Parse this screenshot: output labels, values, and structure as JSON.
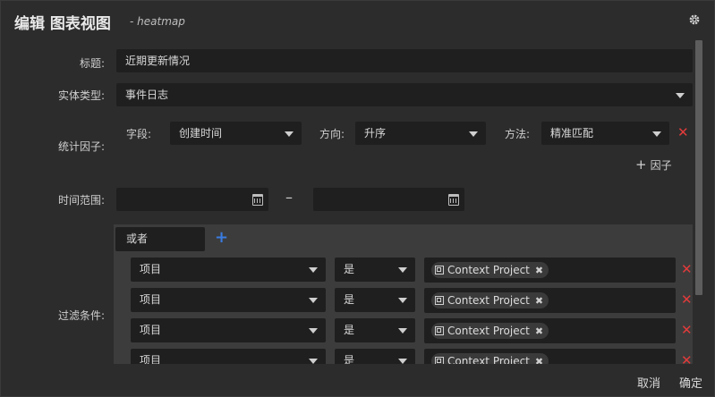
{
  "header": {
    "title": "编辑 图表视图",
    "subtitle": "- heatmap",
    "settings_icon": "gear-icon"
  },
  "form": {
    "title_label": "标题:",
    "title_value": "近期更新情况",
    "entity_label": "实体类型:",
    "entity_value": "事件日志",
    "factor_label": "统计因子:",
    "factor": {
      "field_label": "字段:",
      "field_value": "创建时间",
      "direction_label": "方向:",
      "direction_value": "升序",
      "method_label": "方法:",
      "method_value": "精准匹配",
      "remove_icon": "close-icon"
    },
    "add_factor_plus": "+",
    "add_factor_label": "因子",
    "time_label": "时间范围:",
    "time_start": "",
    "time_end": "",
    "time_dash": "–",
    "calendar_icon": "calendar-icon",
    "filter_label": "过滤条件:",
    "filter_logic": "或者",
    "filter_add_icon": "+",
    "filters": [
      {
        "field": "项目",
        "op": "是",
        "tag": "Context Project"
      },
      {
        "field": "项目",
        "op": "是",
        "tag": "Context Project"
      },
      {
        "field": "项目",
        "op": "是",
        "tag": "Context Project"
      },
      {
        "field": "项目",
        "op": "是",
        "tag": "Context Project"
      }
    ]
  },
  "footer": {
    "cancel_label": "取消",
    "confirm_label": "确定"
  },
  "colors": {
    "background": "#2c2c2c",
    "input_bg": "#1f1f1f",
    "danger": "#e23b3b",
    "accent": "#3a7be0"
  }
}
